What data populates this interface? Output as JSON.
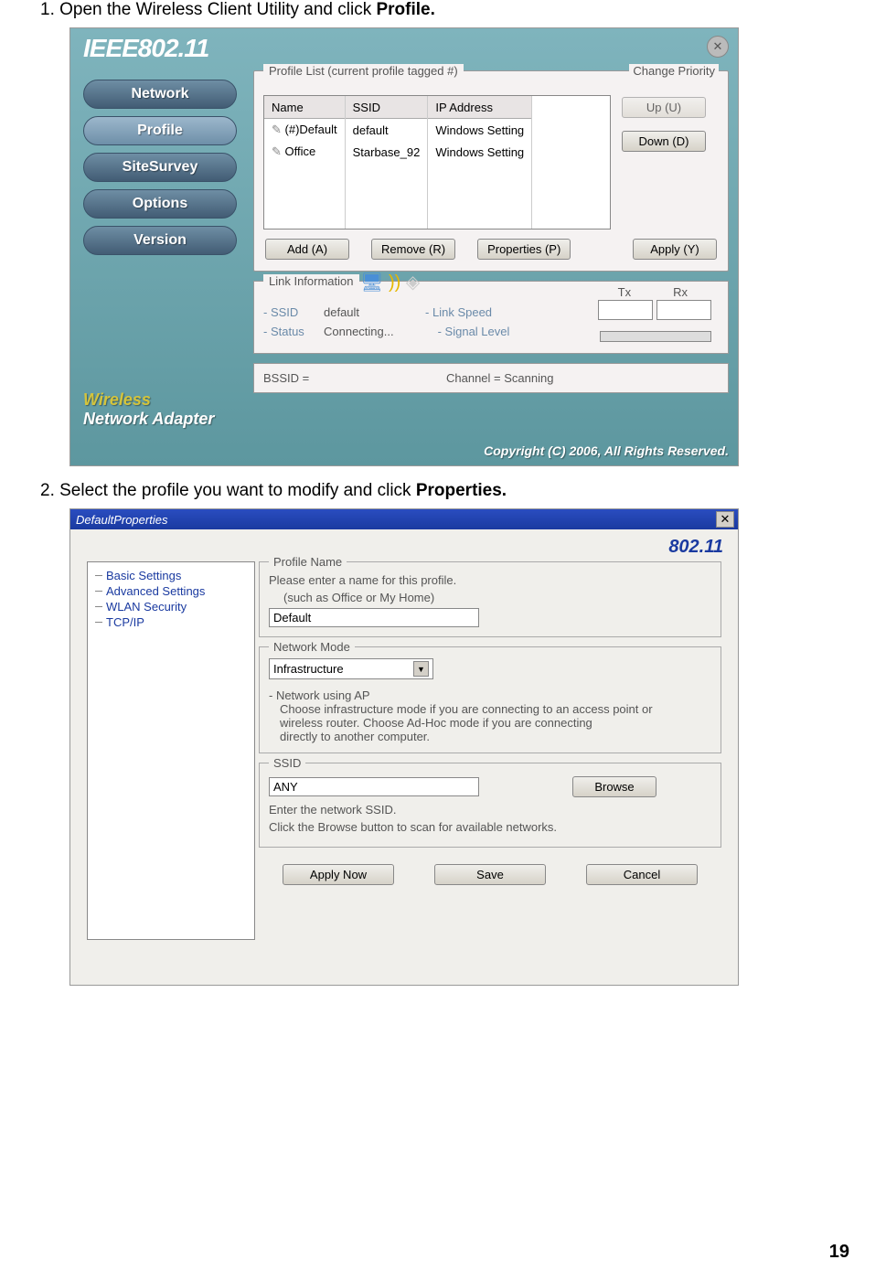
{
  "step1_pre": "1.  Open the Wireless Client Utility and click ",
  "step1_bold": "Profile.",
  "step2_pre": "2.  Select the profile you want to modify and click ",
  "step2_bold": "Properties.",
  "page_number": "19",
  "s1": {
    "logo": "IEEE802.11",
    "close_glyph": "✕",
    "nav": [
      "Network",
      "Profile",
      "SiteSurvey",
      "Options",
      "Version"
    ],
    "profile_list_title": "Profile List (current profile tagged #)",
    "change_priority": "Change Priority",
    "cols": [
      "Name",
      "SSID",
      "IP Address"
    ],
    "rows": [
      {
        "name": "(#)Default",
        "ssid": "default",
        "ip": "Windows Setting"
      },
      {
        "name": "Office",
        "ssid": "Starbase_92",
        "ip": "Windows Setting"
      }
    ],
    "blank_rows": 3,
    "btn_up": "Up (U)",
    "btn_down": "Down (D)",
    "btn_add": "Add (A)",
    "btn_remove": "Remove (R)",
    "btn_props": "Properties (P)",
    "btn_apply": "Apply (Y)",
    "link_title": "Link Information",
    "ssid_lbl": "- SSID",
    "ssid_val": "default",
    "status_lbl": "- Status",
    "status_val": "Connecting...",
    "linkspeed": "- Link Speed",
    "signal": "- Signal Level",
    "tx": "Tx",
    "rx": "Rx",
    "bssid": "BSSID =",
    "channel": "Channel = Scanning",
    "wna1": "Wireless",
    "wna2": "Network Adapter",
    "copyright": "Copyright (C) 2006, All Rights Reserved."
  },
  "s2": {
    "title": "DefaultProperties",
    "brand": "802.11",
    "tree": [
      "Basic Settings",
      "Advanced Settings",
      "WLAN Security",
      "TCP/IP"
    ],
    "pn_leg": "Profile Name",
    "pn_hint1": "Please enter a name for this profile.",
    "pn_hint2": "(such as Office or My Home)",
    "pn_val": "Default",
    "nm_leg": "Network Mode",
    "nm_val": "Infrastructure",
    "nm_note": "- Network using AP",
    "nm_sub1": "Choose infrastructure mode if you are connecting to an access point or",
    "nm_sub2": "wireless router. Choose Ad-Hoc mode if you are connecting",
    "nm_sub3": "directly to another computer.",
    "ssid_leg": "SSID",
    "ssid_val": "ANY",
    "ssid_browse": "Browse",
    "ssid_hint1": "Enter the network SSID.",
    "ssid_hint2": "Click the Browse button to scan for available networks.",
    "btn_apply": "Apply Now",
    "btn_save": "Save",
    "btn_cancel": "Cancel",
    "close_glyph": "✕",
    "arrow": "▼"
  }
}
